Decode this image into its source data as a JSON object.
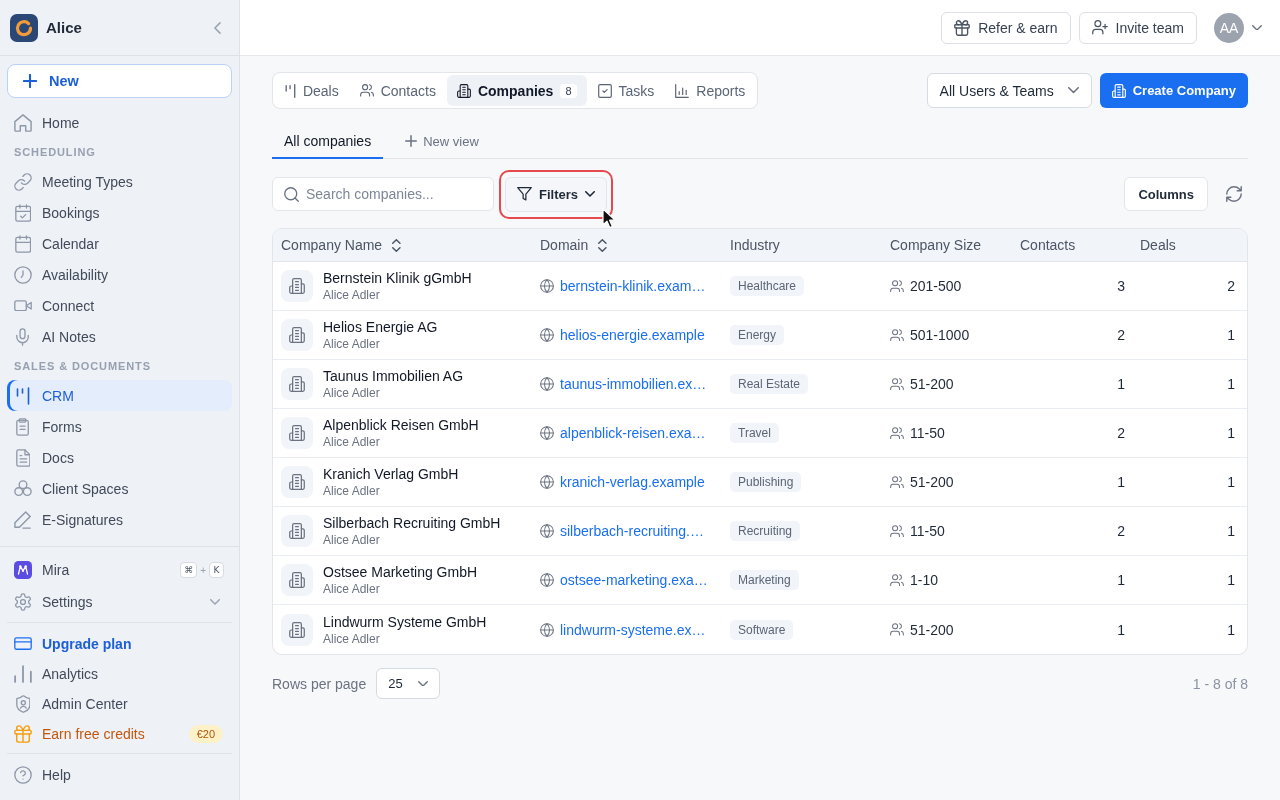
{
  "sidebar": {
    "workspace": "Alice",
    "new_button": "New",
    "sections": [
      {
        "items": [
          {
            "label": "Home",
            "selected": false
          }
        ]
      },
      {
        "heading": "SCHEDULING",
        "items": [
          {
            "label": "Meeting Types",
            "selected": false
          },
          {
            "label": "Bookings",
            "selected": false
          },
          {
            "label": "Calendar",
            "selected": false
          },
          {
            "label": "Availability",
            "selected": false
          },
          {
            "label": "Connect",
            "selected": false
          },
          {
            "label": "AI Notes",
            "selected": false
          }
        ]
      },
      {
        "heading": "SALES & DOCUMENTS",
        "items": [
          {
            "label": "CRM",
            "selected": true
          },
          {
            "label": "Forms",
            "selected": false
          },
          {
            "label": "Docs",
            "selected": false
          },
          {
            "label": "Client Spaces",
            "selected": false
          },
          {
            "label": "E-Signatures",
            "selected": false
          }
        ]
      }
    ],
    "assistant": {
      "label": "Mira",
      "shortcut": {
        "keys": [
          "⌘",
          "K"
        ],
        "separator": "+"
      }
    },
    "settings": {
      "label": "Settings",
      "expanded": false
    },
    "links": [
      {
        "label": "Upgrade plan",
        "kind": "upgrade"
      },
      {
        "label": "Analytics",
        "kind": "plain"
      },
      {
        "label": "Admin Center",
        "kind": "plain"
      },
      {
        "label": "Earn free credits",
        "kind": "reward",
        "badge": "€20"
      }
    ],
    "help": "Help"
  },
  "topbar": {
    "buttons": [
      "Refer & earn",
      "Invite team"
    ],
    "avatar": "AA"
  },
  "module_tabs": [
    {
      "label": "Deals",
      "selected": false
    },
    {
      "label": "Contacts",
      "selected": false
    },
    {
      "label": "Companies",
      "selected": true,
      "count": "8"
    },
    {
      "label": "Tasks",
      "selected": false
    },
    {
      "label": "Reports",
      "selected": false
    }
  ],
  "owner_filter": "All Users & Teams",
  "create_button": "Create Company",
  "views": [
    {
      "label": "All companies",
      "selected": true
    }
  ],
  "new_view": "New view",
  "toolbar": {
    "search": {
      "placeholder": "Search companies..."
    },
    "filters": {
      "label": "Filters",
      "highlighted": true
    },
    "columns_button": "Columns"
  },
  "table": {
    "columns": [
      {
        "label": "Company Name",
        "sortable": true
      },
      {
        "label": "Domain",
        "sortable": true
      },
      {
        "label": "Industry",
        "sortable": false
      },
      {
        "label": "Company Size",
        "sortable": false
      },
      {
        "label": "Contacts",
        "sortable": false
      },
      {
        "label": "Deals",
        "sortable": false
      }
    ],
    "rows": [
      {
        "name": "Bernstein Klinik gGmbH",
        "owner": "Alice Adler",
        "domain": "bernstein-klinik.exam…",
        "industry": "Healthcare",
        "size": "201-500",
        "contacts": "3",
        "deals": "2"
      },
      {
        "name": "Helios Energie AG",
        "owner": "Alice Adler",
        "domain": "helios-energie.example",
        "industry": "Energy",
        "size": "501-1000",
        "contacts": "2",
        "deals": "1"
      },
      {
        "name": "Taunus Immobilien AG",
        "owner": "Alice Adler",
        "domain": "taunus-immobilien.ex…",
        "industry": "Real Estate",
        "size": "51-200",
        "contacts": "1",
        "deals": "1"
      },
      {
        "name": "Alpenblick Reisen GmbH",
        "owner": "Alice Adler",
        "domain": "alpenblick-reisen.exa…",
        "industry": "Travel",
        "size": "11-50",
        "contacts": "2",
        "deals": "1"
      },
      {
        "name": "Kranich Verlag GmbH",
        "owner": "Alice Adler",
        "domain": "kranich-verlag.example",
        "industry": "Publishing",
        "size": "51-200",
        "contacts": "1",
        "deals": "1"
      },
      {
        "name": "Silberbach Recruiting GmbH",
        "owner": "Alice Adler",
        "domain": "silberbach-recruiting.…",
        "industry": "Recruiting",
        "size": "11-50",
        "contacts": "2",
        "deals": "1"
      },
      {
        "name": "Ostsee Marketing GmbH",
        "owner": "Alice Adler",
        "domain": "ostsee-marketing.exa…",
        "industry": "Marketing",
        "size": "1-10",
        "contacts": "1",
        "deals": "1"
      },
      {
        "name": "Lindwurm Systeme GmbH",
        "owner": "Alice Adler",
        "domain": "lindwurm-systeme.ex…",
        "industry": "Software",
        "size": "51-200",
        "contacts": "1",
        "deals": "1"
      }
    ]
  },
  "pagination": {
    "label": "Rows per page",
    "page_size": "25",
    "range": "1 - 8 of 8"
  }
}
